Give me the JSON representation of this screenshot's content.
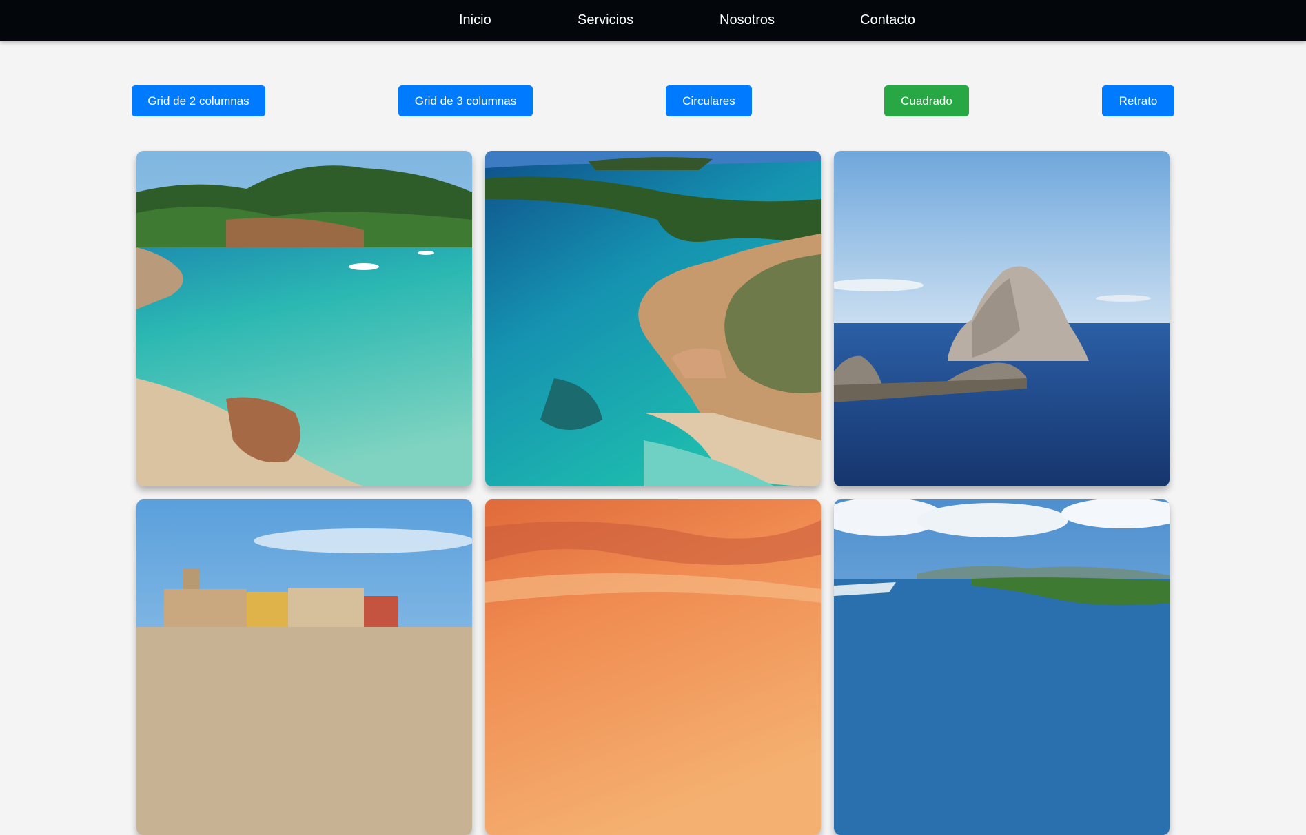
{
  "nav": {
    "items": [
      {
        "label": "Inicio"
      },
      {
        "label": "Servicios"
      },
      {
        "label": "Nosotros"
      },
      {
        "label": "Contacto"
      }
    ]
  },
  "layout_buttons": [
    {
      "label": "Grid de 2 columnas",
      "active": false
    },
    {
      "label": "Grid de 3 columnas",
      "active": false
    },
    {
      "label": "Circulares",
      "active": false
    },
    {
      "label": "Cuadrado",
      "active": true
    },
    {
      "label": "Retrato",
      "active": false
    }
  ],
  "colors": {
    "nav_bg": "#03070b",
    "page_bg": "#f4f4f4",
    "button_default": "#007bff",
    "button_active": "#28a745"
  },
  "gallery": {
    "images": [
      {
        "subject": "beach-cove-photo"
      },
      {
        "subject": "aerial-coast-photo"
      },
      {
        "subject": "rock-island-photo"
      },
      {
        "subject": "old-town-photo"
      },
      {
        "subject": "sunset-sky-photo"
      },
      {
        "subject": "coastline-clouds-photo"
      }
    ]
  }
}
